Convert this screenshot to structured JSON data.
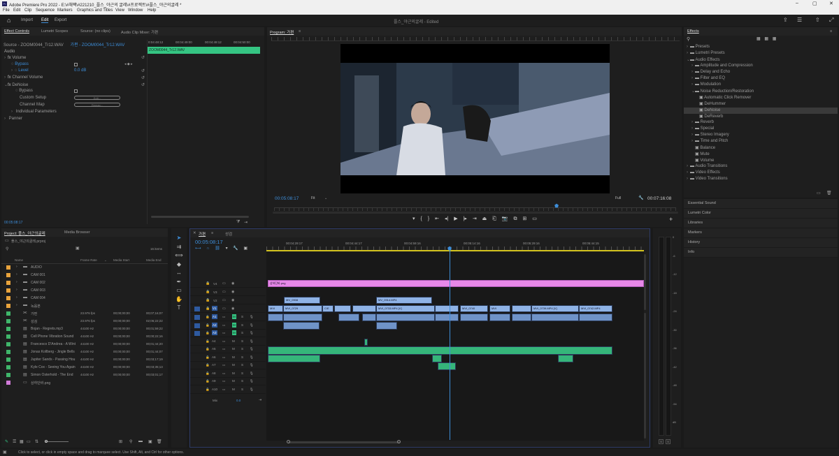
{
  "titlebar": {
    "title": "Adobe Premiere Pro 2022 - E:\\#채팩\\#221210_플스_야근의 굴레\\#프로젝트\\#플스_야근의굴레 *"
  },
  "menu": [
    "File",
    "Edit",
    "Clip",
    "Sequence",
    "Markers",
    "Graphics and Titles",
    "View",
    "Window",
    "Help"
  ],
  "workspace": {
    "tabs": [
      "Import",
      "Edit",
      "Export"
    ],
    "title": "플스_야근의굴레 - Edited"
  },
  "effect_controls": {
    "tabs": [
      "Effect Controls",
      "Lumetri Scopes",
      "Source: (no clips)",
      "Audio Clip Mixer: 가편"
    ],
    "source": "Source - ZOOM0044_Tr12.WAV",
    "sequence": "가편 - ZOOM0044_Tr12.WAV",
    "times": [
      "0:04:48:12",
      "00:04:49:00",
      "00:04:49:12",
      "00:04:50:00"
    ],
    "clip_name": "ZOOM0044_Tr12.WAV",
    "section": "Audio",
    "rows": [
      {
        "label": "Volume",
        "level": 0
      },
      {
        "label": "Bypass",
        "level": 1
      },
      {
        "label": "Level",
        "level": 1,
        "value": "0.0 dB"
      },
      {
        "label": "Channel Volume",
        "level": 0
      },
      {
        "label": "DeNoise",
        "level": 0
      },
      {
        "label": "Bypass",
        "level": 1
      },
      {
        "label": "Custom Setup",
        "level": 1,
        "button": "Edit..."
      },
      {
        "label": "Channel Map",
        "level": 1,
        "button": "Remap..."
      },
      {
        "label": "Individual Parameters",
        "level": 1
      },
      {
        "label": "Panner",
        "level": 0
      }
    ],
    "timecode": "00:05:08:17"
  },
  "program": {
    "title": "Program: 가편",
    "timecode": "00:05:08:17",
    "fit": "Fit",
    "quality": "Full",
    "duration": "00:07:16:08"
  },
  "project": {
    "tabs": [
      "Project: 플스_야근의굴레",
      "Media Browser"
    ],
    "file": "플스_야근의굴레.prproj",
    "items_count": "16 items",
    "columns": [
      "Name",
      "Frame Rate",
      "Media Start",
      "Media End"
    ],
    "items": [
      {
        "name": "AUDIO",
        "color": "#e8a33c",
        "type": "folder",
        "fr": "",
        "ms": "",
        "me": ""
      },
      {
        "name": "CAM 001",
        "color": "#e8a33c",
        "type": "folder",
        "fr": "",
        "ms": "",
        "me": ""
      },
      {
        "name": "CAM 002",
        "color": "#e8a33c",
        "type": "folder",
        "fr": "",
        "ms": "",
        "me": ""
      },
      {
        "name": "CAM 003",
        "color": "#e8a33c",
        "type": "folder",
        "fr": "",
        "ms": "",
        "me": ""
      },
      {
        "name": "CAM 004",
        "color": "#e8a33c",
        "type": "folder",
        "fr": "",
        "ms": "",
        "me": ""
      },
      {
        "name": "녹음본",
        "color": "#e8a33c",
        "type": "folder",
        "fr": "",
        "ms": "",
        "me": ""
      },
      {
        "name": "가편",
        "color": "#3fb56a",
        "type": "seq",
        "fr": "23.976 fps",
        "ms": "00;00;00;00",
        "me": "00;07;16;07"
      },
      {
        "name": "성검",
        "color": "#3fb56a",
        "type": "seq",
        "fr": "23.976 fps",
        "ms": "00;00;00;00",
        "me": "02;06;22;22"
      },
      {
        "name": "Bojan - Regrets.mp3",
        "color": "#3fb56a",
        "type": "aud",
        "fr": "44100 Hz",
        "ms": "00;00;00;00",
        "me": "00;01;59;22"
      },
      {
        "name": "Cell Phone Vibration Sound",
        "color": "#3fb56a",
        "type": "aud",
        "fr": "44100 Hz",
        "ms": "00;00;00;00",
        "me": "00;00;22;16"
      },
      {
        "name": "Francesco D'Andrea - A Wint",
        "color": "#3fb56a",
        "type": "aud",
        "fr": "44100 Hz",
        "ms": "00;00;00;00",
        "me": "00;01;44;20"
      },
      {
        "name": "Jonas Kollberg - Jingle Bells",
        "color": "#3fb56a",
        "type": "aud",
        "fr": "44100 Hz",
        "ms": "00;00;00;00",
        "me": "00;01;44;07"
      },
      {
        "name": "Jupiter Sands - Passing Hou",
        "color": "#3fb56a",
        "type": "aud",
        "fr": "44100 Hz",
        "ms": "00;00;00;00",
        "me": "00;03;17;19"
      },
      {
        "name": "Kyle Cox - Seeing You Again",
        "color": "#3fb56a",
        "type": "aud",
        "fr": "44100 Hz",
        "ms": "00;00;00;00",
        "me": "00;03;35;13"
      },
      {
        "name": "Simon Osterhold - The End",
        "color": "#3fb56a",
        "type": "aud",
        "fr": "44100 Hz",
        "ms": "00;00;00;00",
        "me": "00;03;01;17"
      },
      {
        "name": "상하단바.png",
        "color": "#d07ad8",
        "type": "img",
        "fr": "",
        "ms": "",
        "me": ""
      }
    ]
  },
  "timeline": {
    "tabs": [
      "가편",
      "성검"
    ],
    "timecode": "00:05:08:17",
    "ruler": [
      "00:04:29:17",
      "00:04:44:17",
      "00:04:59:16",
      "00:05:14:16",
      "00:05:29:16",
      "00:05:44:15"
    ],
    "video_tracks": [
      "V4",
      "V3",
      "V2",
      "V1"
    ],
    "audio_tracks": [
      "A1",
      "A2",
      "A3",
      "A4",
      "A5",
      "A6",
      "A7",
      "A8",
      "A9",
      "A10"
    ],
    "mix_label": "Mix",
    "mix_value": "0.0",
    "png_clip": "상하단바.png",
    "v2_clips": [
      "MV_0908",
      "MV_0914.MP4"
    ],
    "v1_clips": [
      "MVI",
      "MVI_0729",
      "C/E",
      "MVI_0733.MP4 [V]",
      "MVI",
      "MVI_0740",
      "MVI",
      "MVI_0739.MP4 [V]",
      "MVI_0742.MP4"
    ]
  },
  "meter": {
    "scale": [
      "0",
      "-6",
      "-12",
      "-18",
      "-24",
      "-30",
      "-36",
      "-42",
      "-48",
      "-54",
      "dB"
    ],
    "solo": [
      "S",
      "S"
    ]
  },
  "effects": {
    "title": "Effects",
    "items": [
      {
        "label": "Presets",
        "level": 0,
        "open": false
      },
      {
        "label": "Lumetri Presets",
        "level": 0,
        "open": false
      },
      {
        "label": "Audio Effects",
        "level": 0,
        "open": true
      },
      {
        "label": "Amplitude and Compression",
        "level": 1,
        "open": false
      },
      {
        "label": "Delay and Echo",
        "level": 1,
        "open": false
      },
      {
        "label": "Filter and EQ",
        "level": 1,
        "open": false
      },
      {
        "label": "Modulation",
        "level": 1,
        "open": false
      },
      {
        "label": "Noise Reduction/Restoration",
        "level": 1,
        "open": true
      },
      {
        "label": "Automatic Click Remover",
        "level": 2,
        "leaf": true
      },
      {
        "label": "DeHummer",
        "level": 2,
        "leaf": true
      },
      {
        "label": "DeNoise",
        "level": 2,
        "leaf": true,
        "selected": true
      },
      {
        "label": "DeReverb",
        "level": 2,
        "leaf": true
      },
      {
        "label": "Reverb",
        "level": 1,
        "open": false
      },
      {
        "label": "Special",
        "level": 1,
        "open": false
      },
      {
        "label": "Stereo Imagery",
        "level": 1,
        "open": false
      },
      {
        "label": "Time and Pitch",
        "level": 1,
        "open": false
      },
      {
        "label": "Balance",
        "level": 1,
        "leaf": true
      },
      {
        "label": "Mute",
        "level": 1,
        "leaf": true
      },
      {
        "label": "Volume",
        "level": 1,
        "leaf": true
      },
      {
        "label": "Audio Transitions",
        "level": 0,
        "open": false
      },
      {
        "label": "Video Effects",
        "level": 0,
        "open": false
      },
      {
        "label": "Video Transitions",
        "level": 0,
        "open": false
      }
    ],
    "sections": [
      "Essential Sound",
      "Lumetri Color",
      "Libraries",
      "Markers",
      "History",
      "Info"
    ]
  },
  "status": "Click to select, or click in empty space and drag to marquee select. Use Shift, Alt, and Ctrl for other options."
}
